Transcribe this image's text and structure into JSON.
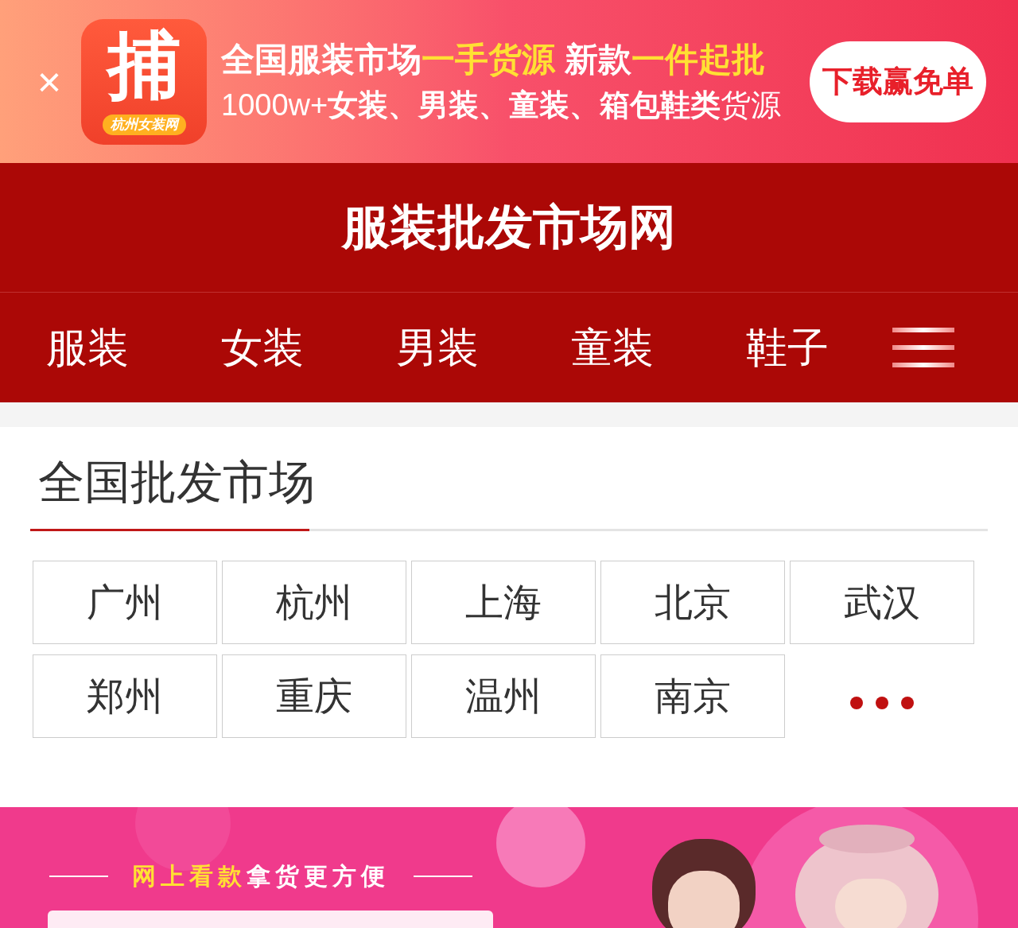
{
  "app_banner": {
    "close": "×",
    "logo": {
      "glyph": "捕",
      "caption": "杭州女装网"
    },
    "headline": [
      {
        "text": "全国服装市场",
        "highlight": false
      },
      {
        "text": "一手货源",
        "highlight": true
      },
      {
        "text": " 新款",
        "highlight": false
      },
      {
        "text": "一件起批",
        "highlight": true
      }
    ],
    "subline": [
      {
        "text": "1000w+",
        "bold": false
      },
      {
        "text": "女装、男装、童装、箱包鞋类",
        "bold": true
      },
      {
        "text": "货源",
        "bold": false
      }
    ],
    "button": "下载赢免单"
  },
  "site_title": "服装批发市场网",
  "nav": {
    "items": [
      "服装",
      "女装",
      "男装",
      "童装",
      "鞋子"
    ]
  },
  "section": {
    "title": "全国批发市场",
    "cities": [
      {
        "kind": "city",
        "label": "广州"
      },
      {
        "kind": "city",
        "label": "杭州"
      },
      {
        "kind": "city",
        "label": "上海"
      },
      {
        "kind": "city",
        "label": "北京"
      },
      {
        "kind": "city",
        "label": "武汉"
      },
      {
        "kind": "city",
        "label": "郑州"
      },
      {
        "kind": "city",
        "label": "重庆"
      },
      {
        "kind": "city",
        "label": "温州"
      },
      {
        "kind": "city",
        "label": "南京"
      },
      {
        "kind": "more"
      }
    ]
  },
  "promo_banner": {
    "kind": "picture",
    "tagline": [
      {
        "text": "网上看款",
        "highlight": true
      },
      {
        "text": "拿货更方便",
        "highlight": false
      }
    ]
  }
}
